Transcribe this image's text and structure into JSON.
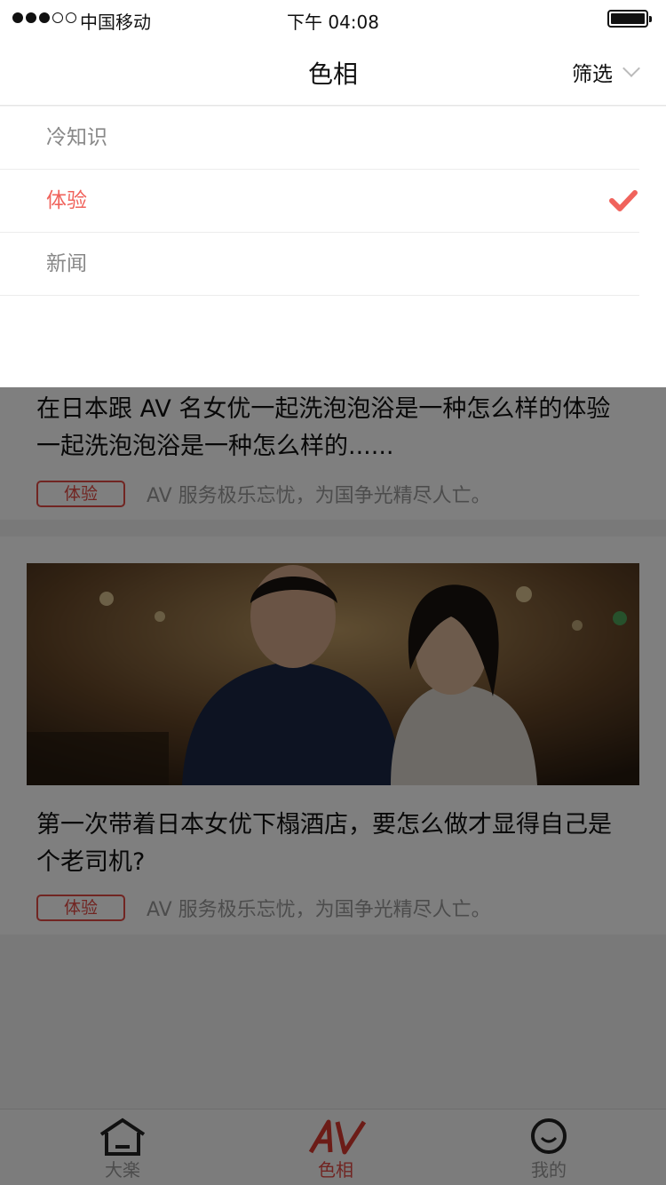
{
  "status": {
    "carrier": "中国移动",
    "time": "下午 04:08"
  },
  "nav": {
    "title": "色相",
    "filter_label": "筛选"
  },
  "dropdown": {
    "items": [
      {
        "label": "冷知识",
        "selected": false
      },
      {
        "label": "体验",
        "selected": true
      },
      {
        "label": "新闻",
        "selected": false
      }
    ]
  },
  "articles": [
    {
      "title": "在日本跟 AV 名女优一起洗泡泡浴是一种怎么样的体验一起洗泡泡浴是一种怎么样的......",
      "tag": "体验",
      "summary": "AV 服务极乐忘忧，为国争光精尽人亡。"
    },
    {
      "title": "第一次带着日本女优下榻酒店，要怎么做才显得自己是个老司机?",
      "tag": "体验",
      "summary": "AV 服务极乐忘忧，为国争光精尽人亡。"
    }
  ],
  "tabs": [
    {
      "label": "大楽",
      "icon": "home-icon"
    },
    {
      "label": "色相",
      "icon": "av-logo-icon"
    },
    {
      "label": "我的",
      "icon": "smile-icon"
    }
  ],
  "colors": {
    "accent": "#f0635c",
    "tag": "#e34a44"
  }
}
